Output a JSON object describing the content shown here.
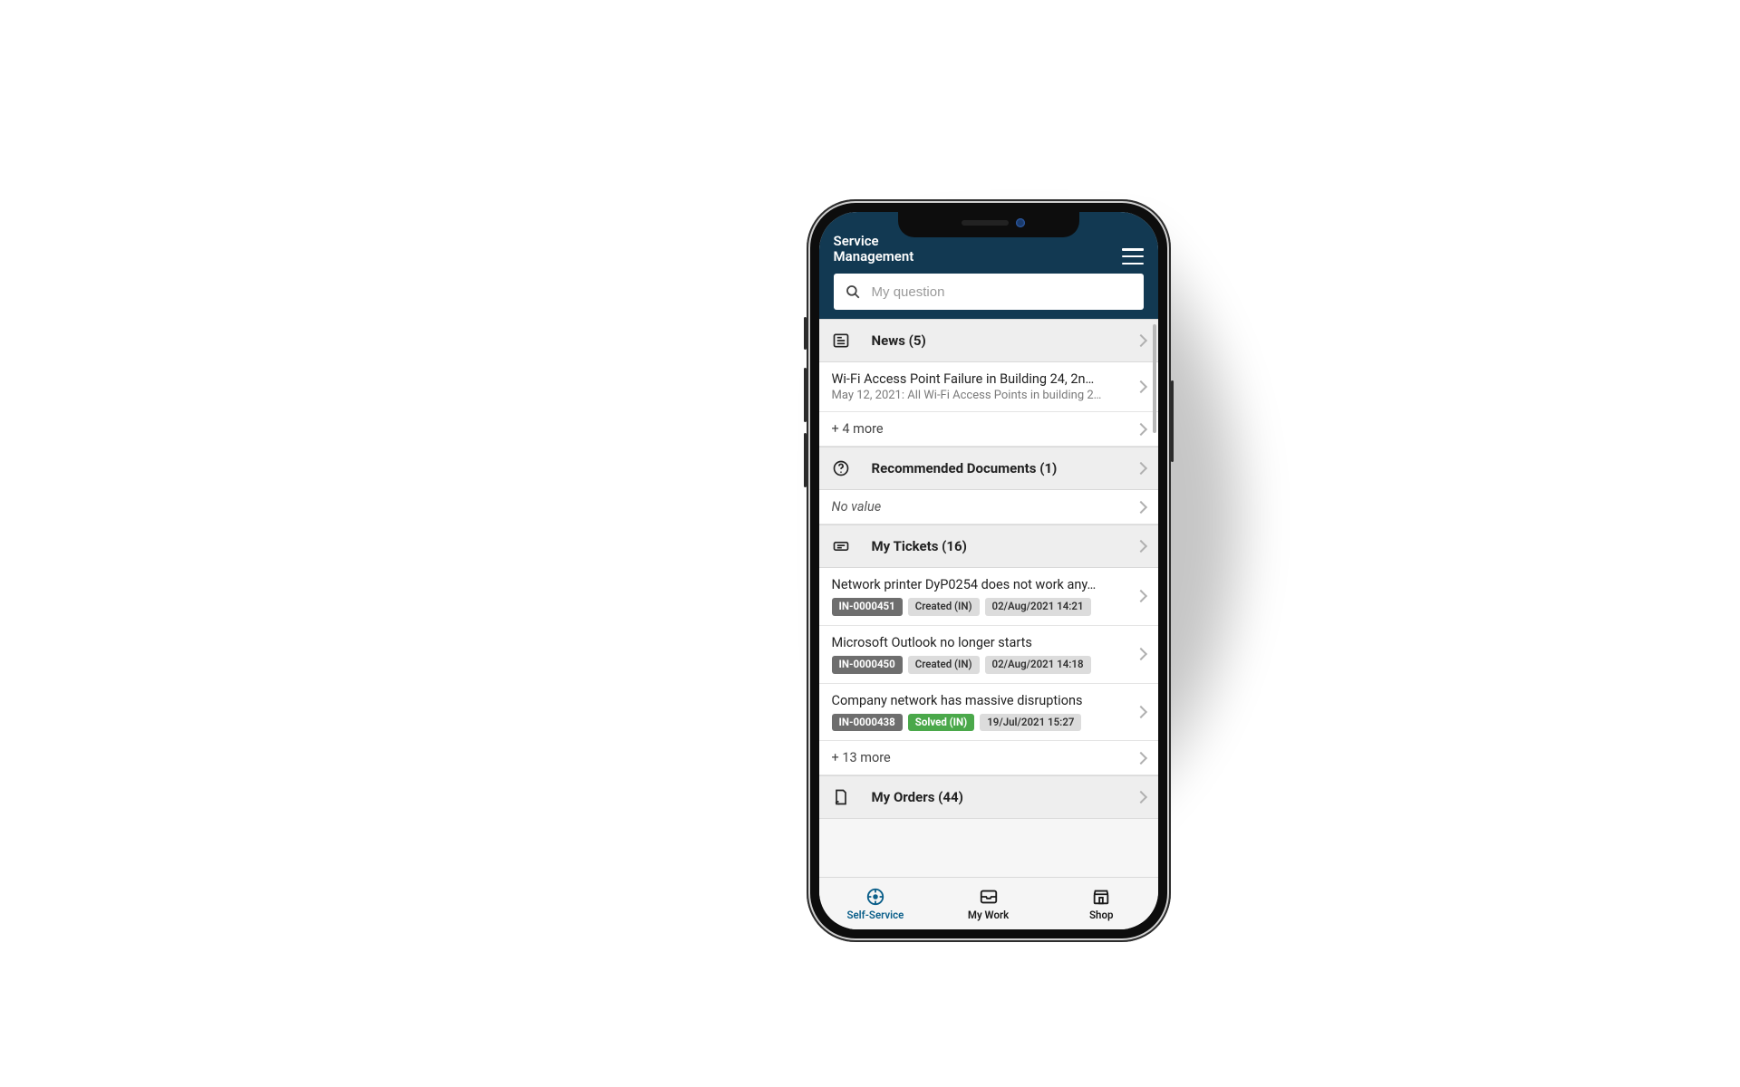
{
  "app": {
    "title": "Service\nManagement"
  },
  "search": {
    "placeholder": "My question"
  },
  "sections": {
    "news": {
      "label": "News (5)",
      "item": {
        "title": "Wi-Fi Access Point Failure in Building 24, 2n…",
        "subtitle": "May 12, 2021: All Wi-Fi Access Points in building 2…"
      },
      "more": "+ 4 more"
    },
    "recommended": {
      "label": "Recommended Documents (1)",
      "novalue": "No value"
    },
    "tickets": {
      "label": "My Tickets (16)",
      "items": [
        {
          "title": "Network printer DyP0254 does not work any…",
          "id": "IN-0000451",
          "status": "Created (IN)",
          "status_kind": "grey",
          "date": "02/Aug/2021 14:21"
        },
        {
          "title": "Microsoft Outlook no longer starts",
          "id": "IN-0000450",
          "status": "Created (IN)",
          "status_kind": "grey",
          "date": "02/Aug/2021 14:18"
        },
        {
          "title": "Company network has massive disruptions",
          "id": "IN-0000438",
          "status": "Solved (IN)",
          "status_kind": "green",
          "date": "19/Jul/2021 15:27"
        }
      ],
      "more": "+ 13 more"
    },
    "orders": {
      "label": "My Orders (44)"
    }
  },
  "nav": {
    "self_service": "Self-Service",
    "my_work": "My Work",
    "shop": "Shop"
  }
}
